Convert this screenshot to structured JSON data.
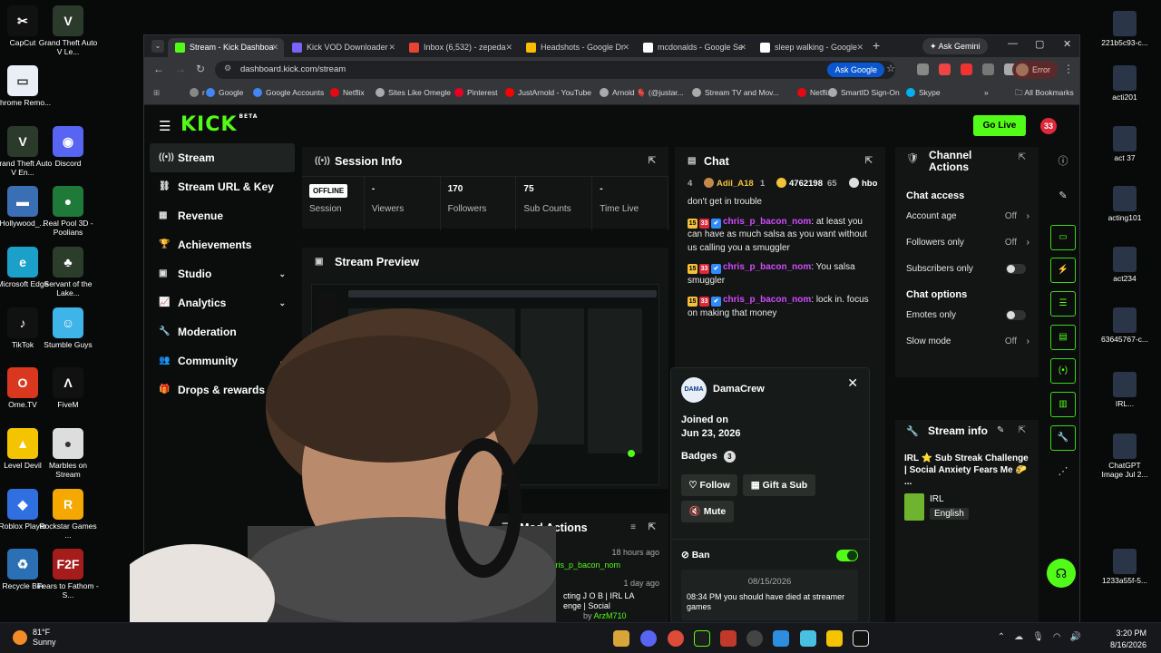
{
  "desktop_left": [
    {
      "label": "CapCut",
      "color": "#111",
      "glyph": "✂"
    },
    {
      "label": "Grand Theft Auto V Le...",
      "color": "#2b3a2b",
      "glyph": "V"
    },
    {
      "label": "Chrome Remo...",
      "color": "#e9eef7",
      "glyph": "▭"
    },
    {
      "label": "Discord",
      "color": "#5865f2",
      "glyph": "◉"
    },
    {
      "label": "Grand Theft Auto V En...",
      "color": "#2b3a2b",
      "glyph": "V"
    },
    {
      "label": "Hollywood_...",
      "color": "#3b6fb5",
      "glyph": "▬"
    },
    {
      "label": "Real Pool 3D - Poolians",
      "color": "#1f7a3a",
      "glyph": "●"
    },
    {
      "label": "Microsoft Edge",
      "color": "#1aa0c9",
      "glyph": "e"
    },
    {
      "label": "Servant of the Lake...",
      "color": "#2c3d2c",
      "glyph": "♣"
    },
    {
      "label": "TikTok",
      "color": "#111",
      "glyph": "♪"
    },
    {
      "label": "Stumble Guys",
      "color": "#3fb4e8",
      "glyph": "☺"
    },
    {
      "label": "Ome.TV",
      "color": "#d9381e",
      "glyph": "O"
    },
    {
      "label": "FiveM",
      "color": "#111",
      "glyph": "Λ"
    },
    {
      "label": "Level Devil",
      "color": "#f4c400",
      "glyph": "▲"
    },
    {
      "label": "Marbles on Stream",
      "color": "#ddd",
      "glyph": "●"
    },
    {
      "label": "Roblox Player",
      "color": "#2f6fe0",
      "glyph": "◆"
    },
    {
      "label": "Rockstar Games ...",
      "color": "#f5a800",
      "glyph": "R"
    },
    {
      "label": "Recycle Bin",
      "color": "#2b6fb5",
      "glyph": "♻"
    },
    {
      "label": "Fears to Fathom - S...",
      "color": "#a51c1c",
      "glyph": "F2F"
    }
  ],
  "desktop_right": [
    "221b5c93-c...",
    "acti201",
    "act 37",
    "acting101",
    "act234",
    "63645767-c...",
    "IRL...",
    "ChatGPT Image Jul 2...",
    "1233a55f-5..."
  ],
  "taskbar": {
    "temp": "81°F",
    "condition": "Sunny",
    "time": "3:20 PM",
    "date": "8/16/2026"
  },
  "browser": {
    "tabs": [
      {
        "label": "Stream - Kick Dashboa",
        "color": "#53fc18"
      },
      {
        "label": "Kick VOD Downloader",
        "color": "#7b61ff"
      },
      {
        "label": "Inbox (6,532) - zepeda",
        "color": "#ea4335"
      },
      {
        "label": "Headshots - Google Dr",
        "color": "#fbbc04"
      },
      {
        "label": "mcdonalds - Google Se",
        "color": "#ffffff"
      },
      {
        "label": "sleep walking - Google",
        "color": "#ffffff"
      }
    ],
    "ask_gemini": "Ask Gemini",
    "url": "dashboard.kick.com/stream",
    "ask_google": "Ask Google",
    "error_label": "Error",
    "bookmarks": [
      {
        "label": "r",
        "color": "#888"
      },
      {
        "label": "Google",
        "color": "#4285f4"
      },
      {
        "label": "Google Accounts",
        "color": "#4285f4"
      },
      {
        "label": "Netflix",
        "color": "#e50914"
      },
      {
        "label": "Sites Like Omegle",
        "color": "#aaa"
      },
      {
        "label": "Pinterest",
        "color": "#e60023"
      },
      {
        "label": "JustArnold - YouTube",
        "color": "#ff0000"
      },
      {
        "label": "Arnold 🫀 (@justar...",
        "color": "#aaa"
      },
      {
        "label": "Stream TV and Mov...",
        "color": "#aaa"
      },
      {
        "label": "Netflix",
        "color": "#e50914"
      },
      {
        "label": "SmartID Sign-On",
        "color": "#aaa"
      },
      {
        "label": "Skype",
        "color": "#00aff0"
      }
    ],
    "all_bookmarks": "All Bookmarks"
  },
  "kick": {
    "logo": "KICK",
    "logo_tag": "BETA",
    "go_live": "Go Live",
    "notif_count": "33",
    "nav": [
      {
        "label": "Stream",
        "icon": "((•))",
        "active": true,
        "chev": false
      },
      {
        "label": "Stream URL & Key",
        "icon": "⛓",
        "active": false,
        "chev": false
      },
      {
        "label": "Revenue",
        "icon": "▦",
        "active": false,
        "chev": false
      },
      {
        "label": "Achievements",
        "icon": "🏆",
        "active": false,
        "chev": false
      },
      {
        "label": "Studio",
        "icon": "▣",
        "active": false,
        "chev": true
      },
      {
        "label": "Analytics",
        "icon": "📈",
        "active": false,
        "chev": true
      },
      {
        "label": "Moderation",
        "icon": "🔧",
        "active": false,
        "chev": false
      },
      {
        "label": "Community",
        "icon": "👥",
        "active": false,
        "chev": true
      },
      {
        "label": "Drops & rewards",
        "icon": "🎁",
        "active": false,
        "chev": false
      }
    ],
    "session": {
      "title": "Session Info",
      "status": "OFFLINE",
      "status_label": "Session",
      "stats": [
        {
          "value": "-",
          "label": "Viewers"
        },
        {
          "value": "170",
          "label": "Followers"
        },
        {
          "value": "75",
          "label": "Sub Counts"
        },
        {
          "value": "-",
          "label": "Time Live"
        }
      ]
    },
    "preview": {
      "title": "Stream Preview"
    },
    "mod_actions": {
      "title": "Mod Actions",
      "entries": [
        {
          "time": "18 hours ago",
          "text": "chris_p_bacon_nom"
        },
        {
          "time": "1 day ago",
          "text": "cting J O B | IRL LA",
          "text2": "enge | Social",
          "by": "by",
          "user": "ArzM710"
        }
      ]
    },
    "chat": {
      "title": "Chat",
      "leaderboard": [
        {
          "rank": "4",
          "name": "Adil_A18",
          "count": "1"
        },
        {
          "value": "4762198",
          "extra": "65"
        },
        {
          "name": "hbo"
        }
      ],
      "messages": [
        {
          "user": "",
          "text": "don't get in trouble"
        },
        {
          "user": "chris_p_bacon_nom",
          "text": ": at least you can have as much salsa as you want without us calling you a smuggler"
        },
        {
          "user": "chris_p_bacon_nom",
          "text": ": You salsa smuggler"
        },
        {
          "user": "chris_p_bacon_nom",
          "text": ": lock in. focus on making that money"
        }
      ],
      "badge_num": "15",
      "badge_num2": "33"
    },
    "usercard": {
      "name": "DamaCrew",
      "joined_label": "Joined on",
      "joined_date": "Jun 23, 2026",
      "badges_label": "Badges",
      "badges_count": "3",
      "follow": "Follow",
      "gift": "Gift a Sub",
      "mute": "Mute",
      "ban": "Ban",
      "log_date": "08/15/2026",
      "log_entry": "08:34 PM you should have died at streamer games"
    },
    "channel_actions": {
      "title_line1": "Channel",
      "title_line2": "Actions",
      "chat_access": "Chat access",
      "rows_access": [
        {
          "label": "Account age",
          "value": "Off",
          "type": "arrow"
        },
        {
          "label": "Followers only",
          "value": "Off",
          "type": "arrow"
        },
        {
          "label": "Subscribers only",
          "value": "",
          "type": "toggle"
        }
      ],
      "chat_options": "Chat options",
      "rows_options": [
        {
          "label": "Emotes only",
          "value": "",
          "type": "toggle"
        },
        {
          "label": "Slow mode",
          "value": "Off",
          "type": "arrow"
        }
      ],
      "stream_info_title": "Stream info",
      "stream_title": "IRL ⭐ Sub Streak Challenge | Social Anxiety Fears Me 🌮 ...",
      "category": "IRL",
      "language": "English"
    }
  }
}
